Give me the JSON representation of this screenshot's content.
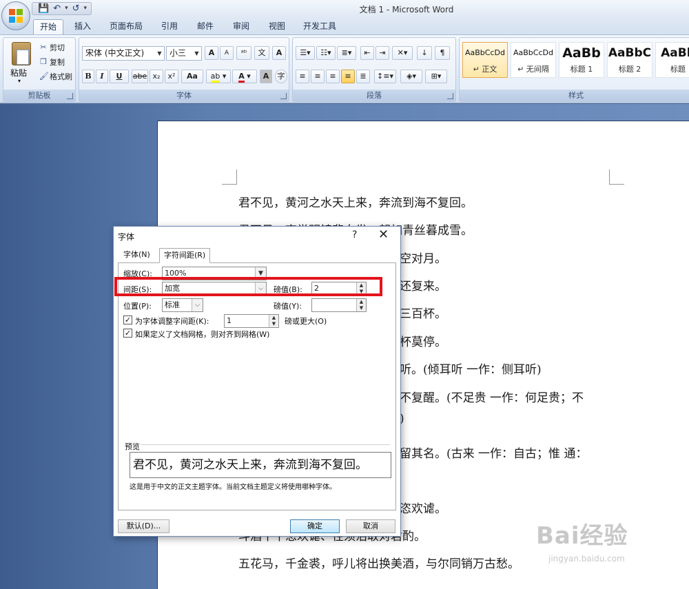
{
  "window": {
    "title": "文档 1 - Microsoft Word"
  },
  "quick_access": {
    "save": "💾",
    "undo": "↶",
    "redo": "↺",
    "more": "▾"
  },
  "tabs": [
    "开始",
    "插入",
    "页面布局",
    "引用",
    "邮件",
    "审阅",
    "视图",
    "开发工具"
  ],
  "ribbon": {
    "clipboard": {
      "label": "剪贴板",
      "paste": "粘贴",
      "cut": "剪切",
      "copy": "复制",
      "format_painter": "格式刷"
    },
    "font": {
      "label": "字体",
      "font_name": "宋体 (中文正文)",
      "font_size": "小三",
      "bold": "B",
      "italic": "I",
      "underline": "U",
      "strike": "abe",
      "subscript": "x₂",
      "superscript": "x²",
      "change_case": "Aa",
      "grow": "A",
      "shrink": "A"
    },
    "paragraph": {
      "label": "段落"
    },
    "styles": {
      "label": "样式",
      "items": [
        {
          "sample": "AaBbCcDd",
          "name": "↵ 正文"
        },
        {
          "sample": "AaBbCcDd",
          "name": "↵ 无间隔"
        },
        {
          "sample": "AaBb",
          "name": "标题 1"
        },
        {
          "sample": "AaBbC",
          "name": "标题 2"
        },
        {
          "sample": "AaBb",
          "name": "标题"
        }
      ]
    }
  },
  "document": {
    "lines": [
      "君不见，黄河之水天上来，奔流到海不复回。",
      "君不见，高堂明镜悲白发，朝如青丝暮成雪。",
      "空对月。",
      "还复来。",
      "三百杯。",
      "杯莫停。",
      "听。(倾耳听 一作：侧耳听)",
      "不复醒。(不足贵 一作：何足贵；不",
      ")",
      "留其名。(古来 一作：自古；惟 通：",
      "恣欢谑。",
      "斗酒十千恣欢谑、径须沽取对君酌。",
      "五花马，千金裘，呼儿将出换美酒，与尔同销万古愁。"
    ]
  },
  "dialog": {
    "title": "字体",
    "help": "?",
    "close": "✕",
    "tabs": [
      "字体(N)",
      "字符间距(R)"
    ],
    "scale_label": "缩放(C):",
    "scale_value": "100%",
    "spacing_label": "间距(S):",
    "spacing_value": "加宽",
    "spacing_by_label": "磅值(B):",
    "spacing_by_value": "2",
    "position_label": "位置(P):",
    "position_value": "标准",
    "position_by_label": "磅值(Y):",
    "position_by_value": "",
    "kerning_label": "为字体调整字间距(K):",
    "kerning_value": "1",
    "kerning_suffix": "磅或更大(O)",
    "grid_label": "如果定义了文档网格，则对齐到网格(W)",
    "preview_label": "预览",
    "preview_text": "君不见，黄河之水天上来，奔流到海不复回。",
    "preview_note": "这是用于中文的正文主题字体。当前文档主题定义将使用哪种字体。",
    "default_button": "默认(D)...",
    "ok_button": "确定",
    "cancel_button": "取消",
    "checkmark": "✓"
  },
  "watermark": {
    "brand": "Bai经验",
    "url": "jingyan.baidu.com"
  },
  "colors": {
    "highlight": "#e3141c",
    "ribbon_bg": "#dbe6f4",
    "doc_bg": "#5d7fb0"
  }
}
